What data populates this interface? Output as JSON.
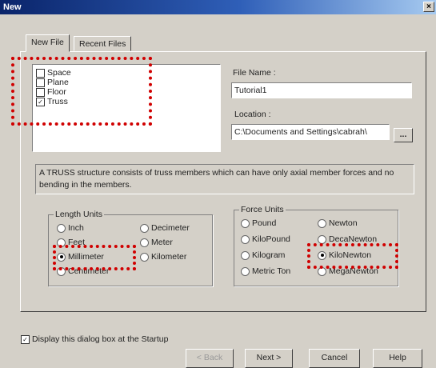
{
  "window": {
    "title": "New",
    "close_glyph": "×"
  },
  "tabs": [
    {
      "label": "New File",
      "active": true
    },
    {
      "label": "Recent Files",
      "active": false
    }
  ],
  "file_types": [
    {
      "label": "Space",
      "checked": false
    },
    {
      "label": "Plane",
      "checked": false
    },
    {
      "label": "Floor",
      "checked": false
    },
    {
      "label": "Truss",
      "checked": true
    }
  ],
  "file_name": {
    "label": "File Name :",
    "value": "Tutorial1"
  },
  "location": {
    "label": "Location :",
    "value": "C:\\Documents and Settings\\cabrah\\",
    "browse_label": "..."
  },
  "description": "A TRUSS structure consists of truss members which can have only axial member forces and no bending in the members.",
  "length_units": {
    "title": "Length Units",
    "options": [
      {
        "label": "Inch",
        "selected": false
      },
      {
        "label": "Feet",
        "selected": false
      },
      {
        "label": "Millimeter",
        "selected": true
      },
      {
        "label": "Centimeter",
        "selected": false
      },
      {
        "label": "Decimeter",
        "selected": false
      },
      {
        "label": "Meter",
        "selected": false
      },
      {
        "label": "Kilometer",
        "selected": false
      }
    ]
  },
  "force_units": {
    "title": "Force Units",
    "options": [
      {
        "label": "Pound",
        "selected": false
      },
      {
        "label": "KiloPound",
        "selected": false
      },
      {
        "label": "Kilogram",
        "selected": false
      },
      {
        "label": "Metric Ton",
        "selected": false
      },
      {
        "label": "Newton",
        "selected": false
      },
      {
        "label": "DecaNewton",
        "selected": false
      },
      {
        "label": "KiloNewton",
        "selected": true
      },
      {
        "label": "MegaNewton",
        "selected": false
      }
    ]
  },
  "startup_checkbox": {
    "label": "Display this dialog box at the Startup",
    "checked": true
  },
  "buttons": {
    "back": "< Back",
    "next": "Next >",
    "cancel": "Cancel",
    "help": "Help"
  },
  "highlight_color": "#d00000"
}
